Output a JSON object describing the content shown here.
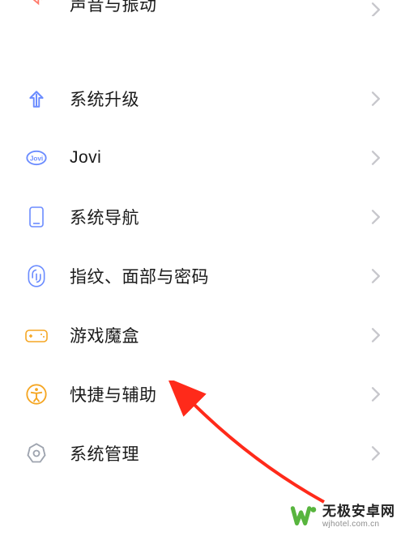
{
  "settings": {
    "partial_top": {
      "label": "声音与振动"
    },
    "items": [
      {
        "label": "系统升级"
      },
      {
        "label": "Jovi"
      },
      {
        "label": "系统导航"
      },
      {
        "label": "指纹、面部与密码"
      },
      {
        "label": "游戏魔盒"
      },
      {
        "label": "快捷与辅助"
      },
      {
        "label": "系统管理"
      }
    ]
  },
  "colors": {
    "blue": "#6b8cff",
    "orange": "#f5a623",
    "gray": "#9ea4af",
    "green": "#58b53e",
    "red": "#ff3b30"
  },
  "watermark": {
    "title": "无极安卓网",
    "subtitle": "wjhotel.com.cn"
  }
}
